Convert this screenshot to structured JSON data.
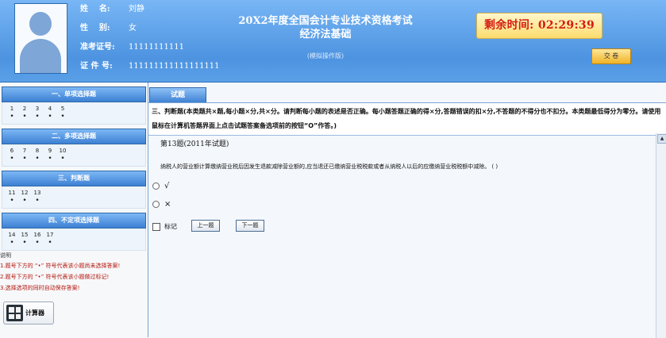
{
  "candidate": {
    "labels": [
      "姓    名:",
      "性    别:",
      "准考证号:",
      "证 件 号:"
    ],
    "values": [
      "刘静",
      "女",
      "11111111111",
      "111111111111111111"
    ]
  },
  "exam": {
    "title_line1": "20X2年度全国会计专业技术资格考试",
    "title_line2": "经济法基础",
    "subtitle": "(模拟操作版)"
  },
  "timer": {
    "text": "剩余时间: 02:29:39"
  },
  "submit": {
    "label": "交 卷"
  },
  "sidebar": {
    "sections": [
      {
        "title": "一、单项选择题",
        "numbers": [
          "1",
          "2",
          "3",
          "4",
          "5"
        ]
      },
      {
        "title": "二、多项选择题",
        "numbers": [
          "6",
          "7",
          "8",
          "9",
          "10"
        ]
      },
      {
        "title": "三、判断题",
        "numbers": [
          "11",
          "12",
          "13"
        ]
      },
      {
        "title": "四、不定项选择题",
        "numbers": [
          "14",
          "15",
          "16",
          "17"
        ]
      }
    ],
    "notes_title": "说明",
    "notes": [
      "1.题号下方的 “•” 符号代表该小题尚未选择答案!",
      "2.题号下方的 “•” 符号代表该小题做过标记!",
      "3.选择选项的同时自动保存答案!"
    ],
    "calculator_label": "计算器"
  },
  "tab": {
    "label": "试题"
  },
  "question": {
    "section_instruction": "三、判断题(本类题共×题,每小题×分,共×分。请判断每小题的表述是否正确。每小题答题正确的得×分,答题错误的扣×分,不答题的不得分也不扣分。本类题最低得分为零分。请使用鼠标在计算机答题界面上点击试题答案备选项前的按钮“O”作答。)",
    "title": "第13题(2011年试题)",
    "text": "纳税人的营业额计算缴纳营业税后因发生退款减除营业额的,应当退还已缴纳营业税税款或者从纳税人以后的应缴纳营业税税额中减除。   (   )",
    "options": [
      "√",
      "×"
    ],
    "mark_label": "标记",
    "prev_label": "上一题",
    "next_label": "下一题"
  }
}
